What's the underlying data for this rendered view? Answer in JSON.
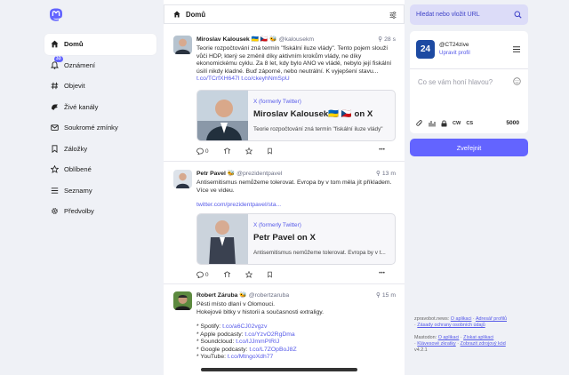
{
  "nav": {
    "badge": "33",
    "items": [
      {
        "label": "Domů",
        "icon": "home-icon"
      },
      {
        "label": "Oznámení",
        "icon": "bell-icon"
      },
      {
        "label": "Objevit",
        "icon": "hashtag-icon"
      },
      {
        "label": "Živé kanály",
        "icon": "live-icon"
      },
      {
        "label": "Soukromé zmínky",
        "icon": "envelope-icon"
      },
      {
        "label": "Záložky",
        "icon": "bookmark-icon"
      },
      {
        "label": "Oblíbené",
        "icon": "star-icon"
      },
      {
        "label": "Seznamy",
        "icon": "list-icon"
      },
      {
        "label": "Předvolby",
        "icon": "gear-icon"
      }
    ]
  },
  "header": {
    "title": "Domů"
  },
  "posts": [
    {
      "name": "Miroslav Kalousek",
      "flags": "🇺🇦 🇨🇿 🐝",
      "handle": "@kalousekm",
      "time": "28 s",
      "text": "Teorie rozpočtování zná termín \"fiskální iluze vlády\". Tento pojem slouží vůči HDP, který se změnil díky aktivním krokům vlády, ne díky ekonomickému cyklu. Za 8 let, kdy bylo ANO ve vládě, nebylo její fiskální úsilí nikdy kladné. Buď záporné, nebo neutrální. K vyjepšení stavu...",
      "link": "t.co/TCrfXH647l t.co/ckeyhNmSpU",
      "card_source": "X (formerly Twitter)",
      "card_title": "Miroslav Kalousek🇺🇦 🇨🇿 on X",
      "card_desc": "Teorie rozpočtování zná termín \"fiskální iluze vlády\"",
      "replies": "0"
    },
    {
      "name": "Petr Pavel",
      "flags": "🐝",
      "handle": "@prezidentpavel",
      "time": "13 m",
      "text1": "Antisemitismus nemůžeme tolerovat. Evropa by v tom měla jít příkladem.",
      "text2": "Více ve videu.",
      "link": "twitter.com/prezidentpavel/sta...",
      "card_source": "X (formerly Twitter)",
      "card_title": "Petr Pavel on X",
      "card_desc": "Antisemitismus nemůžeme tolerovat. Evropa by v t...",
      "replies": "0"
    },
    {
      "name": "Robert Záruba",
      "flags": "🐝",
      "handle": "@robertzaruba",
      "time": "15 m",
      "line1": "Pěsti místo dlaní v Olomouci.",
      "line2": "Hokejové bitky v historii a současnosti extraligy.",
      "items": [
        {
          "label": "* Spotify: ",
          "link": "t.co/a6CJ02vgzv"
        },
        {
          "label": "* Apple podcasty: ",
          "link": "t.co/YzvO2RgDma"
        },
        {
          "label": "* Soundcloud: ",
          "link": "t.co/lJJmmPIRIJ"
        },
        {
          "label": "* Google podcasty: ",
          "link": "t.co/L7ZOpBoJ8Z"
        },
        {
          "label": "* YouTube: ",
          "link": "t.co/MtngoXdh77"
        }
      ]
    }
  ],
  "search": {
    "placeholder": "Hledat nebo vložit URL"
  },
  "compose": {
    "avatar_text": "24",
    "handle": "@CT24zive",
    "edit": "Upravit profil",
    "placeholder": "Co se vám honí hlavou?",
    "cw": "CW",
    "cs": "CS",
    "count": "5000",
    "publish": "Zveřejnit"
  },
  "footer": {
    "site": "zpravobot.news",
    "about": "O aplikaci",
    "admin": "Adresář profilů",
    "privacy": "Zásady ochrany osobních údajů",
    "mastodon": "Mastodon",
    "m_about": "O aplikaci",
    "app": "Získat aplikaci",
    "shortcuts": "Klávesové zkratky",
    "source": "Zobrazit zdrojový kód",
    "version": "v4.2.1"
  },
  "colors": {
    "accent": "#6364ff",
    "link": "#5559e9",
    "background": "#eff1f6"
  }
}
